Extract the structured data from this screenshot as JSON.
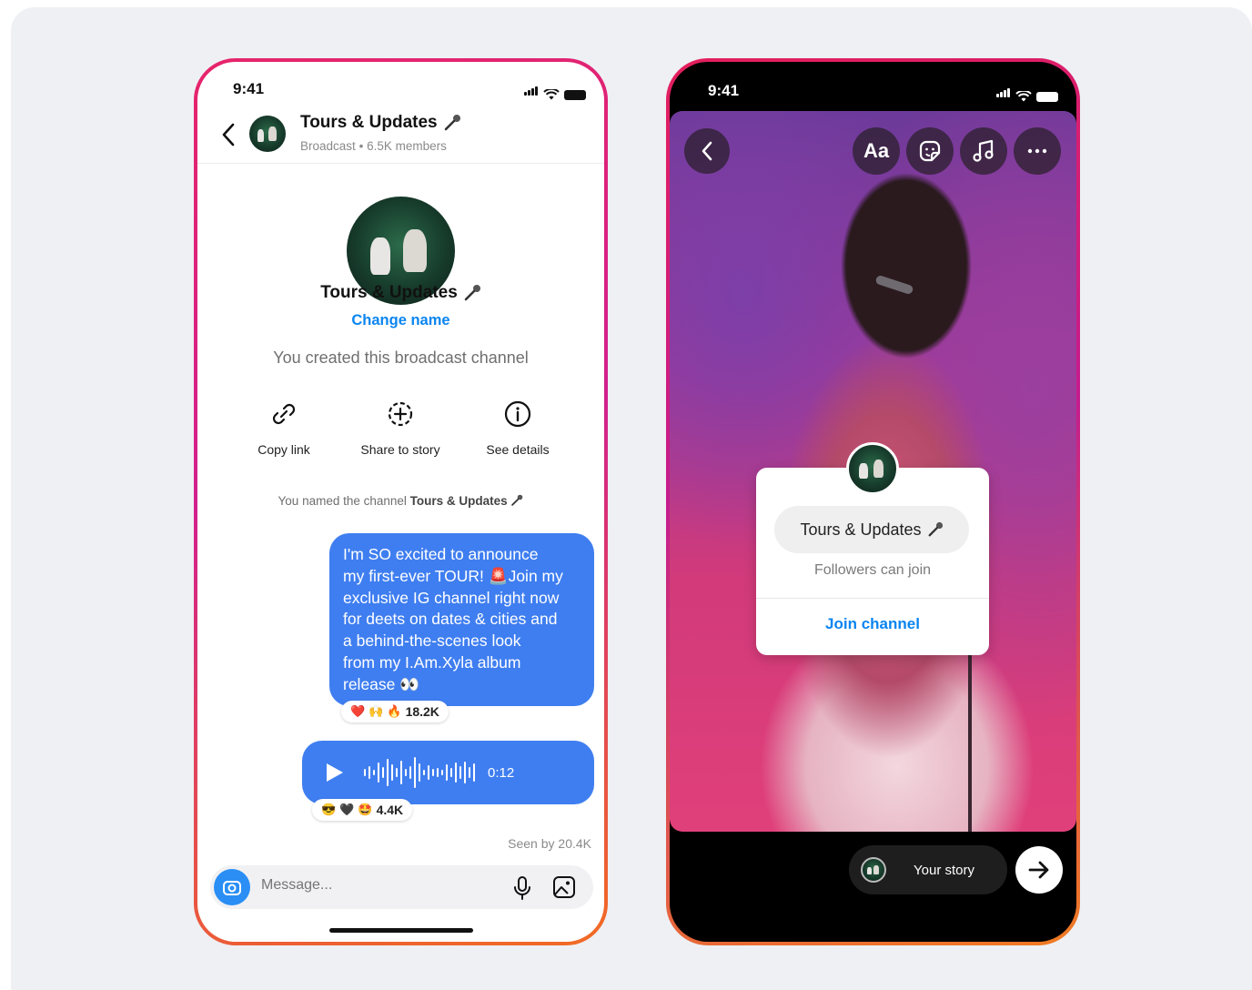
{
  "chat_phone": {
    "status_time": "9:41",
    "header": {
      "title": "Tours & Updates",
      "subtitle_type": "Broadcast",
      "separator": "•",
      "members": "6.5K members"
    },
    "profile": {
      "name": "Tours & Updates",
      "change_name": "Change name",
      "created_text": "You created this broadcast channel"
    },
    "actions": [
      {
        "label": "Copy link",
        "icon": "link-icon"
      },
      {
        "label": "Share to story",
        "icon": "add-story-icon"
      },
      {
        "label": "See details",
        "icon": "info-icon"
      }
    ],
    "system_note": {
      "prefix": "You named the channel",
      "channel": "Tours & Updates"
    },
    "message_text": "I'm SO excited to announce my first-ever TOUR! 🚨Join my exclusive IG channel right now for deets on dates & cities and a behind-the-scenes look from my I.Am.Xyla album release 👀",
    "message_lines": [
      "I'm SO excited to announce",
      "my first-ever TOUR! 🚨Join my",
      "exclusive IG channel right now",
      "for deets on dates & cities and",
      "a behind-the-scenes look",
      "from my I.Am.Xyla album",
      "release 👀"
    ],
    "message_reactions": {
      "emojis": [
        "❤️",
        "🙌",
        "🔥"
      ],
      "count": "18.2K"
    },
    "voice_note": {
      "duration": "0:12",
      "icon": "play-icon"
    },
    "voice_reactions": {
      "emojis": [
        "😎",
        "🖤",
        "🤩"
      ],
      "count": "4.4K"
    },
    "seen_by": "Seen by 20.4K",
    "composer": {
      "placeholder": "Message...",
      "icons": [
        "camera-icon",
        "microphone-icon",
        "gallery-icon"
      ]
    }
  },
  "story_phone": {
    "status_time": "9:41",
    "tools": {
      "text_tool": "Aa",
      "icons": [
        "back-icon",
        "sticker-icon",
        "music-icon",
        "more-icon"
      ]
    },
    "sticker": {
      "channel_name": "Tours & Updates",
      "subtitle": "Followers can join",
      "cta": "Join channel"
    },
    "footer": {
      "your_story": "Your story",
      "icon": "arrow-right-icon"
    }
  },
  "colors": {
    "accent_blue": "#0a85f0",
    "bubble_blue": "#3f7ef0",
    "ring_gradient_start": "#e6246a",
    "ring_gradient_end": "#f26b23"
  }
}
